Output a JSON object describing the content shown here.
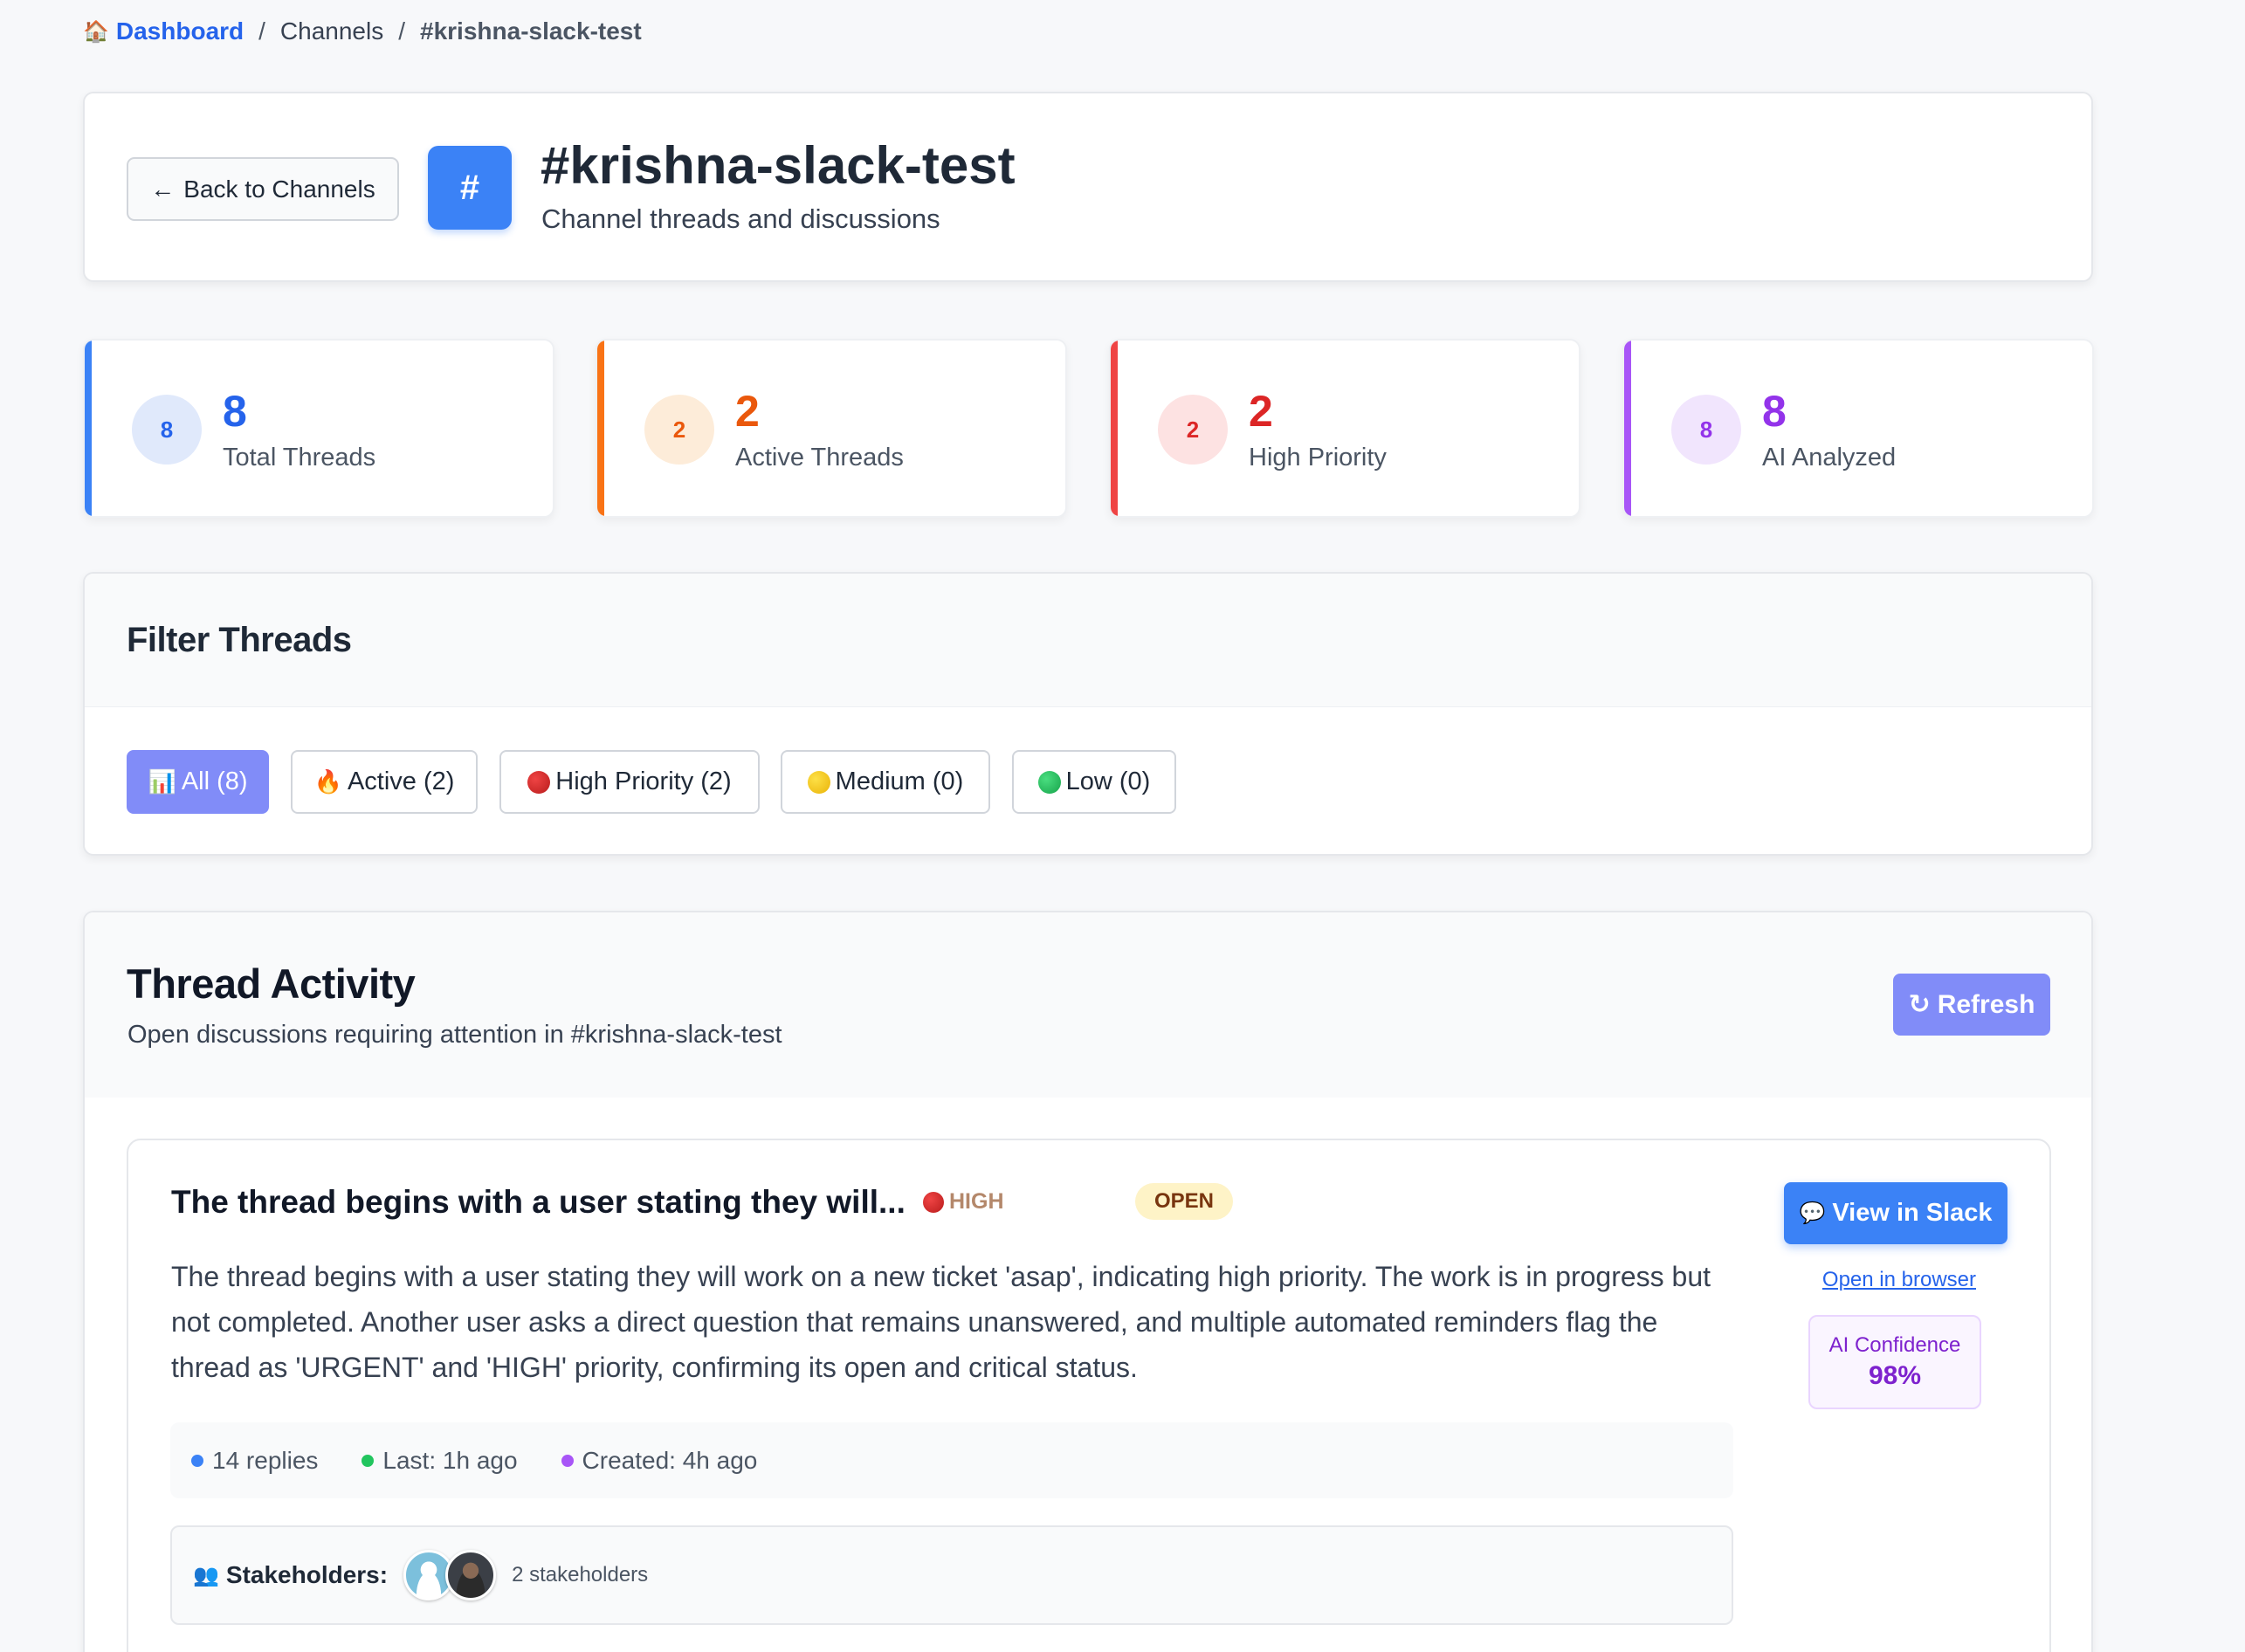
{
  "breadcrumb": {
    "home_icon": "house-icon",
    "dashboard": "Dashboard",
    "sep": "/",
    "channels": "Channels",
    "current": "#krishna-slack-test"
  },
  "header": {
    "back_label": "Back to Channels",
    "hash": "#",
    "title": "#krishna-slack-test",
    "subtitle": "Channel threads and discussions"
  },
  "stats": [
    {
      "value": "8",
      "badge": "8",
      "label": "Total Threads",
      "color": "#3b82f6",
      "badge_bg": "#e0e9fb",
      "num_color": "#2563eb"
    },
    {
      "value": "2",
      "badge": "2",
      "label": "Active Threads",
      "color": "#f97316",
      "badge_bg": "#fdecd9",
      "num_color": "#ea580c"
    },
    {
      "value": "2",
      "badge": "2",
      "label": "High Priority",
      "color": "#ef4444",
      "badge_bg": "#fde2e2",
      "num_color": "#dc2626"
    },
    {
      "value": "8",
      "badge": "8",
      "label": "AI Analyzed",
      "color": "#a855f7",
      "badge_bg": "#f1e5fd",
      "num_color": "#9333ea"
    }
  ],
  "filters": {
    "title": "Filter Threads",
    "buttons": [
      {
        "label": "All (8)",
        "icon": "📊"
      },
      {
        "label": "Active (2)",
        "icon": "🔥"
      },
      {
        "label": "High Priority (2)",
        "icon": "red-circle-icon"
      },
      {
        "label": "Medium (0)",
        "icon": "yellow-circle-icon"
      },
      {
        "label": "Low (0)",
        "icon": "green-circle-icon"
      }
    ]
  },
  "activity": {
    "title": "Thread Activity",
    "subtitle": "Open discussions requiring attention in #krishna-slack-test",
    "refresh_label": "Refresh"
  },
  "thread": {
    "title": "The thread begins with a user stating they will...",
    "priority": "HIGH",
    "status": "OPEN",
    "body": "The thread begins with a user stating they will work on a new ticket 'asap', indicating high priority. The work is in progress but not completed. Another user asks a direct question that remains unanswered, and multiple automated reminders flag the thread as 'URGENT' and 'HIGH' priority, confirming its open and critical status.",
    "replies": "14 replies",
    "last": "Last: 1h ago",
    "created": "Created: 4h ago",
    "stakeholders_label": "Stakeholders:",
    "stakeholders_count": "2 stakeholders",
    "view_slack": "View in Slack",
    "open_browser": "Open in browser",
    "confidence_label": "AI Confidence",
    "confidence_value": "98%"
  }
}
